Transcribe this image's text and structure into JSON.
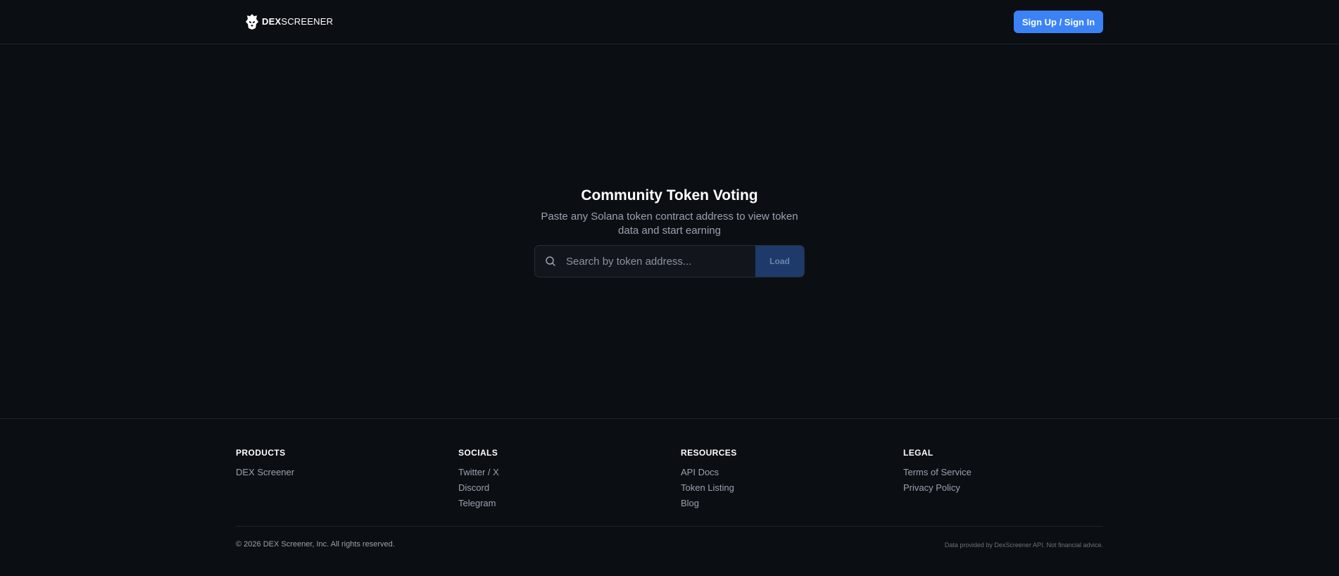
{
  "header": {
    "logo_bold": "DEX",
    "logo_light": "SCREENER",
    "signin_label": "Sign Up / Sign In"
  },
  "hero": {
    "title": "Community Token Voting",
    "subtitle": "Paste any Solana token contract address to view token data and start earning"
  },
  "search": {
    "placeholder": "Search by token address...",
    "value": "",
    "load_label": "Load",
    "icon": "search-icon"
  },
  "footer": {
    "columns": [
      {
        "heading": "PRODUCTS",
        "links": [
          "DEX Screener"
        ]
      },
      {
        "heading": "SOCIALS",
        "links": [
          "Twitter / X",
          "Discord",
          "Telegram"
        ]
      },
      {
        "heading": "RESOURCES",
        "links": [
          "API Docs",
          "Token Listing",
          "Blog"
        ]
      },
      {
        "heading": "LEGAL",
        "links": [
          "Terms of Service",
          "Privacy Policy"
        ]
      }
    ],
    "copyright": "© 2026 DEX Screener, Inc. All rights reserved.",
    "disclaimer": "Data provided by DexScreener API. Not financial advice."
  },
  "colors": {
    "background": "#0b0e13",
    "accent": "#3b82f6",
    "load_button": "#1e3a6b",
    "muted_text": "#9aa3ae"
  }
}
